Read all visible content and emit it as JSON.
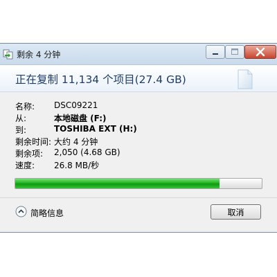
{
  "window": {
    "title": "剩余 4 分钟"
  },
  "header": {
    "text": "正在复制 11,134 个项目(27.4 GB)"
  },
  "details": {
    "name_label": "名称:",
    "name_value": "DSC09221",
    "from_label": "从:",
    "from_value": "本地磁盘 (F:)",
    "to_label": "到:",
    "to_value": "TOSHIBA EXT (H:)",
    "time_label": "剩余时间:",
    "time_value": "大约 4 分钟",
    "items_label": "剩余项:",
    "items_value": "2,050 (4.68 GB)",
    "speed_label": "速度:",
    "speed_value": "26.8 MB/秒"
  },
  "progress": {
    "percent": 83,
    "color": "#21b321"
  },
  "footer": {
    "less_info_label": "简略信息",
    "cancel_label": "取消"
  },
  "icons": {
    "title": "copy-icon",
    "header": "document-icon",
    "toggle": "chevron-up-icon"
  }
}
